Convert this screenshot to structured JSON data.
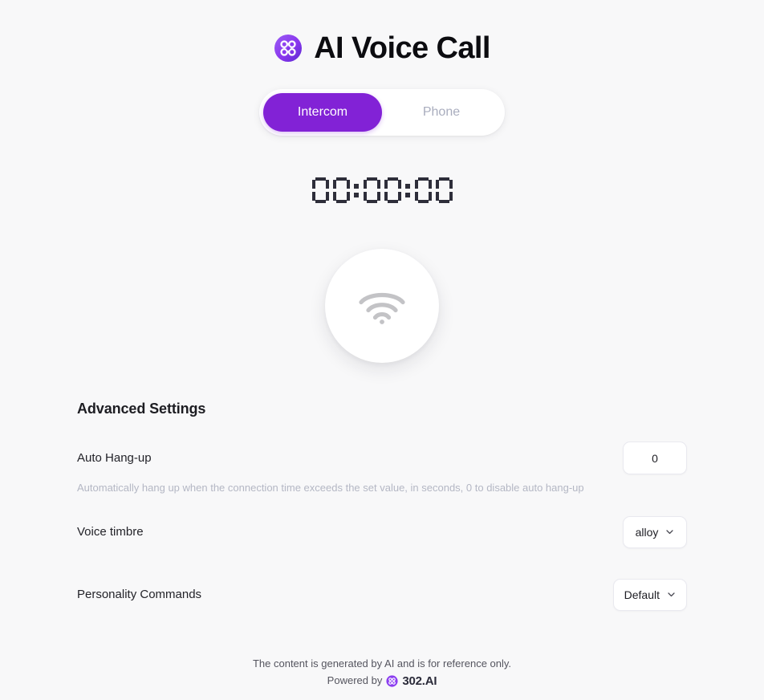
{
  "header": {
    "title": "AI Voice Call",
    "logo_icon": "302ai-clover-logo-icon",
    "logo_color": "#8b3df0"
  },
  "tabs": {
    "active_index": 0,
    "active_color": "#8222d6",
    "items": [
      {
        "label": "Intercom",
        "active": true
      },
      {
        "label": "Phone",
        "active": false
      }
    ]
  },
  "timer": {
    "display": "00:00:00",
    "hours": "00",
    "minutes": "00",
    "seconds": "00",
    "separator": ":"
  },
  "call_button": {
    "icon": "wifi-icon",
    "icon_color": "#c3c3c6",
    "state_label": "idle"
  },
  "settings": {
    "title": "Advanced Settings",
    "auto_hangup": {
      "label": "Auto Hang-up",
      "value": "0",
      "placeholder": "0",
      "hint": "Automatically hang up when the connection time exceeds the set value, in seconds, 0 to disable auto hang-up"
    },
    "voice_timbre": {
      "label": "Voice timbre",
      "value": "alloy",
      "chevron_icon": "chevron-down-icon"
    },
    "personality_commands": {
      "label": "Personality Commands",
      "value": "Default",
      "chevron_icon": "chevron-down-icon"
    }
  },
  "footer": {
    "disclaimer": "The content is generated by AI and is for reference only.",
    "powered_by": "Powered by",
    "brand": "302.AI",
    "logo_icon": "302ai-clover-logo-icon"
  }
}
